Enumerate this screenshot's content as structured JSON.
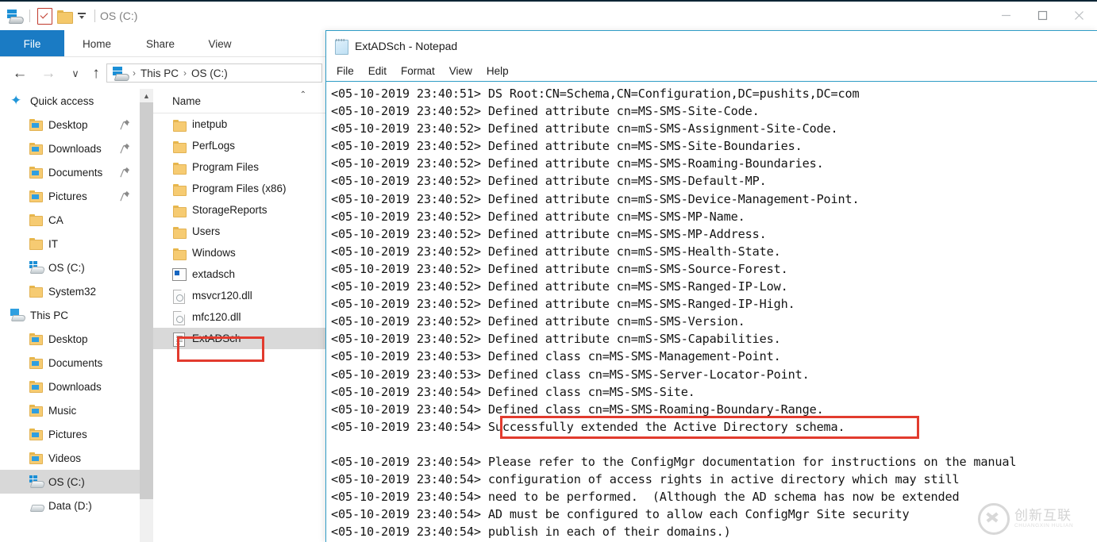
{
  "explorer": {
    "title": "OS (C:)",
    "quick_access_toolbar": {
      "pc_icon": "this-pc-icon",
      "properties_icon": "properties-checkbox-icon",
      "new_folder_icon": "new-folder-icon",
      "customize_icon": "customize-caret-icon"
    },
    "window_controls": {
      "minimize": "minimize-icon",
      "maximize": "maximize-icon",
      "close": "close-icon"
    },
    "ribbon_tabs": [
      {
        "label": "File",
        "active": true
      },
      {
        "label": "Home",
        "active": false
      },
      {
        "label": "Share",
        "active": false
      },
      {
        "label": "View",
        "active": false
      }
    ],
    "navigation": {
      "back": "←",
      "forward": "→",
      "recent": "∨",
      "up": "↑"
    },
    "breadcrumb": {
      "icon": "this-pc-icon",
      "items": [
        "This PC",
        "OS (C:)"
      ],
      "separator": "›"
    },
    "nav_pane": [
      {
        "label": "Quick access",
        "icon": "star-icon",
        "indent": 0,
        "pinned": false,
        "selected": false
      },
      {
        "label": "Desktop",
        "icon": "folder-desktop-icon",
        "indent": 1,
        "pinned": true,
        "selected": false
      },
      {
        "label": "Downloads",
        "icon": "folder-downloads-icon",
        "indent": 1,
        "pinned": true,
        "selected": false
      },
      {
        "label": "Documents",
        "icon": "folder-documents-icon",
        "indent": 1,
        "pinned": true,
        "selected": false
      },
      {
        "label": "Pictures",
        "icon": "folder-pictures-icon",
        "indent": 1,
        "pinned": true,
        "selected": false
      },
      {
        "label": "CA",
        "icon": "folder-icon",
        "indent": 1,
        "pinned": false,
        "selected": false
      },
      {
        "label": "IT",
        "icon": "folder-icon",
        "indent": 1,
        "pinned": false,
        "selected": false
      },
      {
        "label": "OS (C:)",
        "icon": "drive-windows-icon",
        "indent": 1,
        "pinned": false,
        "selected": false
      },
      {
        "label": "System32",
        "icon": "folder-icon",
        "indent": 1,
        "pinned": false,
        "selected": false
      },
      {
        "label": "This PC",
        "icon": "this-pc-icon",
        "indent": 0,
        "pinned": false,
        "selected": false
      },
      {
        "label": "Desktop",
        "icon": "folder-desktop-icon",
        "indent": 1,
        "pinned": false,
        "selected": false
      },
      {
        "label": "Documents",
        "icon": "folder-documents-icon",
        "indent": 1,
        "pinned": false,
        "selected": false
      },
      {
        "label": "Downloads",
        "icon": "folder-downloads-icon",
        "indent": 1,
        "pinned": false,
        "selected": false
      },
      {
        "label": "Music",
        "icon": "folder-music-icon",
        "indent": 1,
        "pinned": false,
        "selected": false
      },
      {
        "label": "Pictures",
        "icon": "folder-pictures-icon",
        "indent": 1,
        "pinned": false,
        "selected": false
      },
      {
        "label": "Videos",
        "icon": "folder-videos-icon",
        "indent": 1,
        "pinned": false,
        "selected": false
      },
      {
        "label": "OS (C:)",
        "icon": "drive-windows-icon",
        "indent": 1,
        "pinned": false,
        "selected": true
      },
      {
        "label": "Data (D:)",
        "icon": "drive-icon",
        "indent": 1,
        "pinned": false,
        "selected": false
      }
    ],
    "file_list": {
      "column_header": "Name",
      "sort_indicator": "⌃",
      "rows": [
        {
          "name": "inetpub",
          "icon": "folder-icon",
          "selected": false,
          "highlighted": false
        },
        {
          "name": "PerfLogs",
          "icon": "folder-icon",
          "selected": false,
          "highlighted": false
        },
        {
          "name": "Program Files",
          "icon": "folder-icon",
          "selected": false,
          "highlighted": false
        },
        {
          "name": "Program Files (x86)",
          "icon": "folder-icon",
          "selected": false,
          "highlighted": false
        },
        {
          "name": "StorageReports",
          "icon": "folder-icon",
          "selected": false,
          "highlighted": false
        },
        {
          "name": "Users",
          "icon": "folder-icon",
          "selected": false,
          "highlighted": false
        },
        {
          "name": "Windows",
          "icon": "folder-icon",
          "selected": false,
          "highlighted": false
        },
        {
          "name": "extadsch",
          "icon": "application-icon",
          "selected": false,
          "highlighted": false
        },
        {
          "name": "msvcr120.dll",
          "icon": "dll-icon",
          "selected": false,
          "highlighted": false
        },
        {
          "name": "mfc120.dll",
          "icon": "dll-icon",
          "selected": false,
          "highlighted": false
        },
        {
          "name": "ExtADSch",
          "icon": "text-file-icon",
          "selected": true,
          "highlighted": true
        }
      ]
    }
  },
  "notepad": {
    "title": "ExtADSch - Notepad",
    "icon": "notepad-icon",
    "menus": [
      "File",
      "Edit",
      "Format",
      "View",
      "Help"
    ],
    "highlighted_line_index": 20,
    "lines": [
      "<05-10-2019 23:40:51> DS Root:CN=Schema,CN=Configuration,DC=pushits,DC=com",
      "<05-10-2019 23:40:52> Defined attribute cn=MS-SMS-Site-Code.",
      "<05-10-2019 23:40:52> Defined attribute cn=mS-SMS-Assignment-Site-Code.",
      "<05-10-2019 23:40:52> Defined attribute cn=MS-SMS-Site-Boundaries.",
      "<05-10-2019 23:40:52> Defined attribute cn=MS-SMS-Roaming-Boundaries.",
      "<05-10-2019 23:40:52> Defined attribute cn=MS-SMS-Default-MP.",
      "<05-10-2019 23:40:52> Defined attribute cn=mS-SMS-Device-Management-Point.",
      "<05-10-2019 23:40:52> Defined attribute cn=MS-SMS-MP-Name.",
      "<05-10-2019 23:40:52> Defined attribute cn=MS-SMS-MP-Address.",
      "<05-10-2019 23:40:52> Defined attribute cn=mS-SMS-Health-State.",
      "<05-10-2019 23:40:52> Defined attribute cn=mS-SMS-Source-Forest.",
      "<05-10-2019 23:40:52> Defined attribute cn=MS-SMS-Ranged-IP-Low.",
      "<05-10-2019 23:40:52> Defined attribute cn=MS-SMS-Ranged-IP-High.",
      "<05-10-2019 23:40:52> Defined attribute cn=mS-SMS-Version.",
      "<05-10-2019 23:40:52> Defined attribute cn=mS-SMS-Capabilities.",
      "<05-10-2019 23:40:53> Defined class cn=MS-SMS-Management-Point.",
      "<05-10-2019 23:40:53> Defined class cn=MS-SMS-Server-Locator-Point.",
      "<05-10-2019 23:40:54> Defined class cn=MS-SMS-Site.",
      "<05-10-2019 23:40:54> Defined class cn=MS-SMS-Roaming-Boundary-Range.",
      "<05-10-2019 23:40:54> Successfully extended the Active Directory schema.",
      "",
      "<05-10-2019 23:40:54> Please refer to the ConfigMgr documentation for instructions on the manual",
      "<05-10-2019 23:40:54> configuration of access rights in active directory which may still",
      "<05-10-2019 23:40:54> need to be performed.  (Although the AD schema has now be extended",
      "<05-10-2019 23:40:54> AD must be configured to allow each ConfigMgr Site security",
      "<05-10-2019 23:40:54> publish in each of their domains.)"
    ]
  },
  "watermark": {
    "chinese": "创新互联",
    "pinyin": "CHUANGXIN HULIAN"
  },
  "colors": {
    "ribbon_accent": "#1a7bc4",
    "notepad_border": "#2f9cc6",
    "annotation_red": "#e23b2e",
    "selection_grey": "#d9d9d9",
    "titlebar_top": "#0b2535"
  }
}
